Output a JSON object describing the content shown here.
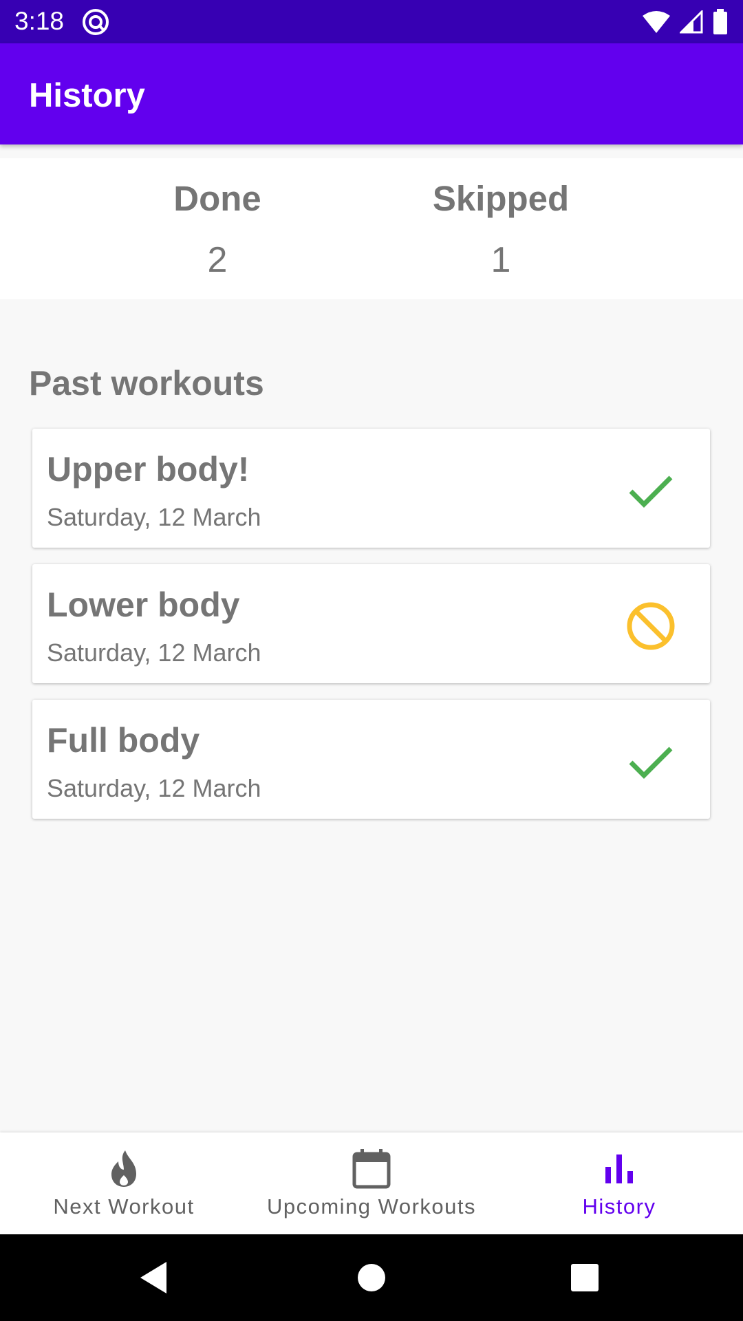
{
  "status_bar": {
    "time": "3:18",
    "icons": [
      "app-notification-icon",
      "wifi-icon",
      "signal-icon",
      "battery-icon"
    ]
  },
  "app_bar": {
    "title": "History"
  },
  "summary": {
    "done_label": "Done",
    "done_value": "2",
    "skipped_label": "Skipped",
    "skipped_value": "1"
  },
  "past_workouts": {
    "title": "Past workouts",
    "items": [
      {
        "name": "Upper body!",
        "date": "Saturday, 12 March",
        "status": "done",
        "status_icon": "check-icon"
      },
      {
        "name": "Lower body",
        "date": "Saturday, 12 March",
        "status": "skipped",
        "status_icon": "block-icon"
      },
      {
        "name": "Full body",
        "date": "Saturday, 12 March",
        "status": "done",
        "status_icon": "check-icon"
      }
    ]
  },
  "bottom_nav": {
    "items": [
      {
        "label": "Next Workout",
        "icon": "fire-icon",
        "active": false
      },
      {
        "label": "Upcoming Workouts",
        "icon": "calendar-icon",
        "active": false
      },
      {
        "label": "History",
        "icon": "bar-chart-icon",
        "active": true
      }
    ]
  },
  "colors": {
    "status_bar": "#3700b3",
    "primary": "#6200ee",
    "done": "#4caf50",
    "skipped": "#fbc02d",
    "text": "#757575"
  }
}
